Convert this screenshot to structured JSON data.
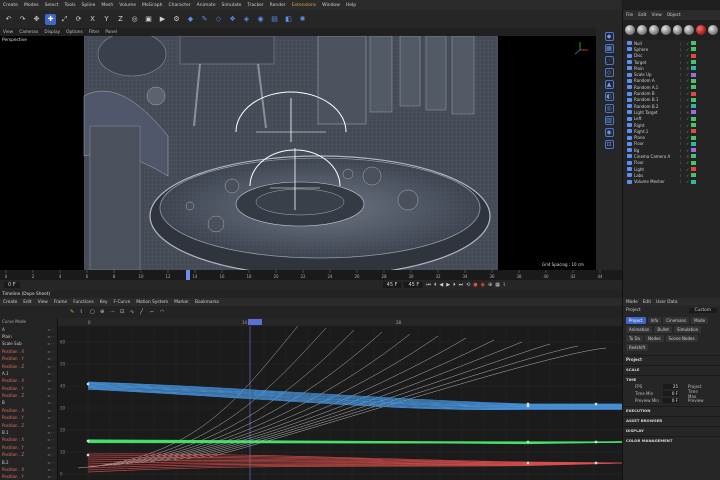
{
  "menubar": {
    "items": [
      "Create",
      "Modes",
      "Select",
      "Tools",
      "Spline",
      "Mesh",
      "Volume",
      "MoGraph",
      "Character",
      "Animate",
      "Simulate",
      "Tracker",
      "Render",
      "Extensions",
      "Window",
      "Help"
    ],
    "active_index": 13
  },
  "viewport": {
    "menu": [
      "View",
      "Cameras",
      "Display",
      "Options",
      "Filter",
      "Panel"
    ],
    "label": "Perspective",
    "grid_spacing": "Grid Spacing : 10 cm"
  },
  "object_manager": {
    "menu": [
      "File",
      "Edit",
      "View",
      "Object"
    ],
    "objects": [
      {
        "name": "Null"
      },
      {
        "name": "Sphere"
      },
      {
        "name": "Disc"
      },
      {
        "name": "Target"
      },
      {
        "name": "Plain"
      },
      {
        "name": "Scale Up"
      },
      {
        "name": "Random A"
      },
      {
        "name": "Random A.1"
      },
      {
        "name": "Random B"
      },
      {
        "name": "Random B.1"
      },
      {
        "name": "Random B.2"
      },
      {
        "name": "Light Target"
      },
      {
        "name": "Left"
      },
      {
        "name": "Right"
      },
      {
        "name": "Right.1"
      },
      {
        "name": "Plane"
      },
      {
        "name": "Floor"
      },
      {
        "name": "Bg"
      },
      {
        "name": "Cinema Camera A"
      },
      {
        "name": "Floor"
      },
      {
        "name": "Light"
      },
      {
        "name": "Labs"
      },
      {
        "name": "Volume Mesher"
      }
    ]
  },
  "timeline_ruler": {
    "ticks": [
      "0",
      "2",
      "4",
      "6",
      "8",
      "10",
      "12",
      "14",
      "16",
      "18",
      "20",
      "22",
      "24",
      "26",
      "28",
      "30",
      "32",
      "34",
      "36",
      "38",
      "40",
      "42",
      "44"
    ],
    "current_frame_marker": "14"
  },
  "playback": {
    "start_field": "0 F",
    "end_field": "45 F",
    "end_field2": "45 F"
  },
  "timeline": {
    "title": "Timeline (Dope Sheet)",
    "menu": [
      "Create",
      "Edit",
      "View",
      "Frame",
      "Functions",
      "Key",
      "F-Curve",
      "Motion System",
      "Marker",
      "Bookmarks"
    ],
    "ruler_labels": [
      "0",
      "14",
      "28"
    ],
    "curve_mode": "Curve Mode",
    "tracks": [
      {
        "label": "A",
        "red": false
      },
      {
        "label": "Plain",
        "red": false
      },
      {
        "label": "Scale Sub",
        "red": false
      },
      {
        "label": "Position . X",
        "red": true
      },
      {
        "label": "Position . Y",
        "red": true
      },
      {
        "label": "Position . Z",
        "red": true
      },
      {
        "label": "A.1",
        "red": false
      },
      {
        "label": "Position . X",
        "red": true
      },
      {
        "label": "Position . Y",
        "red": true
      },
      {
        "label": "Position . Z",
        "red": true
      },
      {
        "label": "B",
        "red": false
      },
      {
        "label": "Position . X",
        "red": true
      },
      {
        "label": "Position . Y",
        "red": true
      },
      {
        "label": "Position . Z",
        "red": true
      },
      {
        "label": "B.1",
        "red": false
      },
      {
        "label": "Position . X",
        "red": true
      },
      {
        "label": "Position . Y",
        "red": true
      },
      {
        "label": "Position . Z",
        "red": true
      },
      {
        "label": "B.2",
        "red": false
      },
      {
        "label": "Position . X",
        "red": true
      },
      {
        "label": "Position . Y",
        "red": true
      }
    ],
    "y_axis_labels": [
      "60",
      "50",
      "40",
      "30",
      "20",
      "10",
      "0"
    ]
  },
  "attributes": {
    "menu": [
      "Mode",
      "Edit",
      "User Data"
    ],
    "title": "Project",
    "mode_value": "Custom",
    "tabs": [
      {
        "label": "Project",
        "on": true
      },
      {
        "label": "Info",
        "on": false
      },
      {
        "label": "Cinemans",
        "on": false
      },
      {
        "label": "Mode",
        "on": false
      },
      {
        "label": "Animation",
        "on": false
      },
      {
        "label": "Bullet",
        "on": false
      },
      {
        "label": "Simulation",
        "on": false
      },
      {
        "label": "To Do",
        "on": false
      },
      {
        "label": "Nodes",
        "on": false
      },
      {
        "label": "Scene Nodes",
        "on": false
      },
      {
        "label": "Redshift",
        "on": false
      }
    ],
    "section_project": "Project",
    "section_scale": "SCALE",
    "section_time": "TIME",
    "fps_label": "FPS",
    "fps_value": "25",
    "project_label": "Project",
    "tmin_label": "Time Min",
    "tmin_value": "0 F",
    "tmax_label": "Time Max",
    "prev_label": "Preview Min",
    "prev_value": "0 F",
    "prev2_label": "Preview",
    "sections_bottom": [
      "EXECUTION",
      "ASSET BROWSER",
      "DISPLAY",
      "COLOR MANAGEMENT"
    ]
  },
  "colors": {
    "accent": "#3f66c9",
    "curve_blue": "#4a9be8",
    "curve_green": "#47e06a",
    "curve_red": "#e05050",
    "curve_white": "#d8d8d8"
  }
}
